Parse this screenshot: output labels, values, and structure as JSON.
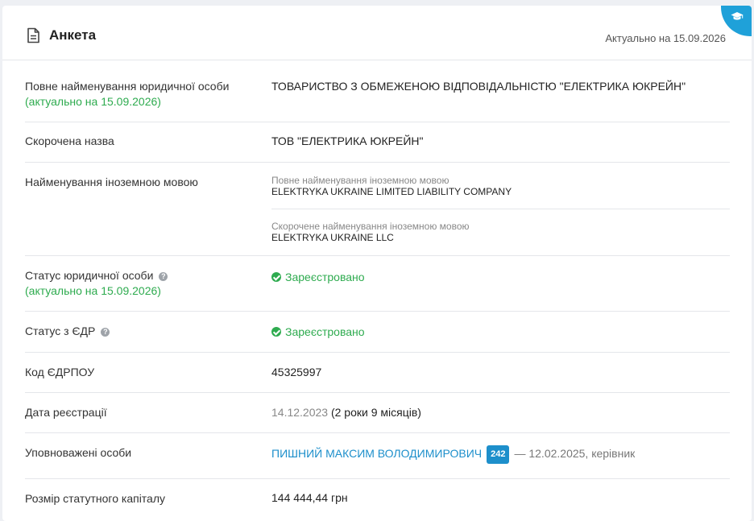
{
  "header": {
    "title": "Анкета",
    "actual": "Актуально на 15.09.2026"
  },
  "rows": {
    "full_name": {
      "label": "Повне найменування юридичної особи",
      "note": "(актуально на 15.09.2026)",
      "value": "ТОВАРИСТВО З ОБМЕЖЕНОЮ ВІДПОВІДАЛЬНІСТЮ \"ЕЛЕКТРИКА ЮКРЕЙН\""
    },
    "short_name": {
      "label": "Скорочена назва",
      "value": "ТОВ \"ЕЛЕКТРИКА ЮКРЕЙН\""
    },
    "foreign": {
      "label": "Найменування іноземною мовою",
      "full_caption": "Повне найменування іноземною мовою",
      "full_value": "ELEKTRYKA UKRAINE LIMITED LIABILITY COMPANY",
      "short_caption": "Скорочене найменування іноземною мовою",
      "short_value": "ELEKTRYKA UKRAINE LLC"
    },
    "status": {
      "label": "Статус юридичної особи",
      "note": "(актуально на 15.09.2026)",
      "value": "Зареєстровано"
    },
    "edr_status": {
      "label": "Статус з ЄДР",
      "value": "Зареєстровано"
    },
    "edrpou": {
      "label": "Код ЄДРПОУ",
      "value": "45325997"
    },
    "reg_date": {
      "label": "Дата реєстрації",
      "date": "14.12.2023",
      "duration": "(2 роки 9 місяців)"
    },
    "authorized": {
      "label": "Уповноважені особи",
      "name": "ПИШНИЙ МАКСИМ ВОЛОДИМИРОВИЧ",
      "badge": "242",
      "info": "— 12.02.2025, керівник"
    },
    "capital": {
      "label": "Розмір статутного капіталу",
      "value": "144 444,44 грн"
    }
  },
  "icons": {
    "corner": "graduation-cap-icon",
    "title": "document-icon",
    "help": "question-icon",
    "status": "check-circle-icon"
  },
  "colors": {
    "accent": "#1fa1d9",
    "link": "#1d8fcb",
    "success": "#2eab4f"
  }
}
